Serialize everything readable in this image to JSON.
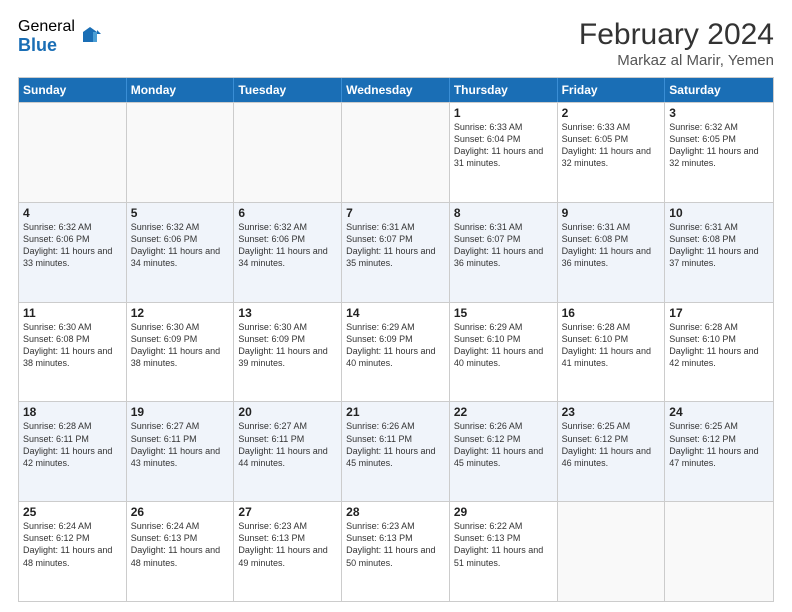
{
  "header": {
    "logo_general": "General",
    "logo_blue": "Blue",
    "month_year": "February 2024",
    "location": "Markaz al Marir, Yemen"
  },
  "days_of_week": [
    "Sunday",
    "Monday",
    "Tuesday",
    "Wednesday",
    "Thursday",
    "Friday",
    "Saturday"
  ],
  "weeks": [
    [
      {
        "day": "",
        "sunrise": "",
        "sunset": "",
        "daylight": ""
      },
      {
        "day": "",
        "sunrise": "",
        "sunset": "",
        "daylight": ""
      },
      {
        "day": "",
        "sunrise": "",
        "sunset": "",
        "daylight": ""
      },
      {
        "day": "",
        "sunrise": "",
        "sunset": "",
        "daylight": ""
      },
      {
        "day": "1",
        "sunrise": "Sunrise: 6:33 AM",
        "sunset": "Sunset: 6:04 PM",
        "daylight": "Daylight: 11 hours and 31 minutes."
      },
      {
        "day": "2",
        "sunrise": "Sunrise: 6:33 AM",
        "sunset": "Sunset: 6:05 PM",
        "daylight": "Daylight: 11 hours and 32 minutes."
      },
      {
        "day": "3",
        "sunrise": "Sunrise: 6:32 AM",
        "sunset": "Sunset: 6:05 PM",
        "daylight": "Daylight: 11 hours and 32 minutes."
      }
    ],
    [
      {
        "day": "4",
        "sunrise": "Sunrise: 6:32 AM",
        "sunset": "Sunset: 6:06 PM",
        "daylight": "Daylight: 11 hours and 33 minutes."
      },
      {
        "day": "5",
        "sunrise": "Sunrise: 6:32 AM",
        "sunset": "Sunset: 6:06 PM",
        "daylight": "Daylight: 11 hours and 34 minutes."
      },
      {
        "day": "6",
        "sunrise": "Sunrise: 6:32 AM",
        "sunset": "Sunset: 6:06 PM",
        "daylight": "Daylight: 11 hours and 34 minutes."
      },
      {
        "day": "7",
        "sunrise": "Sunrise: 6:31 AM",
        "sunset": "Sunset: 6:07 PM",
        "daylight": "Daylight: 11 hours and 35 minutes."
      },
      {
        "day": "8",
        "sunrise": "Sunrise: 6:31 AM",
        "sunset": "Sunset: 6:07 PM",
        "daylight": "Daylight: 11 hours and 36 minutes."
      },
      {
        "day": "9",
        "sunrise": "Sunrise: 6:31 AM",
        "sunset": "Sunset: 6:08 PM",
        "daylight": "Daylight: 11 hours and 36 minutes."
      },
      {
        "day": "10",
        "sunrise": "Sunrise: 6:31 AM",
        "sunset": "Sunset: 6:08 PM",
        "daylight": "Daylight: 11 hours and 37 minutes."
      }
    ],
    [
      {
        "day": "11",
        "sunrise": "Sunrise: 6:30 AM",
        "sunset": "Sunset: 6:08 PM",
        "daylight": "Daylight: 11 hours and 38 minutes."
      },
      {
        "day": "12",
        "sunrise": "Sunrise: 6:30 AM",
        "sunset": "Sunset: 6:09 PM",
        "daylight": "Daylight: 11 hours and 38 minutes."
      },
      {
        "day": "13",
        "sunrise": "Sunrise: 6:30 AM",
        "sunset": "Sunset: 6:09 PM",
        "daylight": "Daylight: 11 hours and 39 minutes."
      },
      {
        "day": "14",
        "sunrise": "Sunrise: 6:29 AM",
        "sunset": "Sunset: 6:09 PM",
        "daylight": "Daylight: 11 hours and 40 minutes."
      },
      {
        "day": "15",
        "sunrise": "Sunrise: 6:29 AM",
        "sunset": "Sunset: 6:10 PM",
        "daylight": "Daylight: 11 hours and 40 minutes."
      },
      {
        "day": "16",
        "sunrise": "Sunrise: 6:28 AM",
        "sunset": "Sunset: 6:10 PM",
        "daylight": "Daylight: 11 hours and 41 minutes."
      },
      {
        "day": "17",
        "sunrise": "Sunrise: 6:28 AM",
        "sunset": "Sunset: 6:10 PM",
        "daylight": "Daylight: 11 hours and 42 minutes."
      }
    ],
    [
      {
        "day": "18",
        "sunrise": "Sunrise: 6:28 AM",
        "sunset": "Sunset: 6:11 PM",
        "daylight": "Daylight: 11 hours and 42 minutes."
      },
      {
        "day": "19",
        "sunrise": "Sunrise: 6:27 AM",
        "sunset": "Sunset: 6:11 PM",
        "daylight": "Daylight: 11 hours and 43 minutes."
      },
      {
        "day": "20",
        "sunrise": "Sunrise: 6:27 AM",
        "sunset": "Sunset: 6:11 PM",
        "daylight": "Daylight: 11 hours and 44 minutes."
      },
      {
        "day": "21",
        "sunrise": "Sunrise: 6:26 AM",
        "sunset": "Sunset: 6:11 PM",
        "daylight": "Daylight: 11 hours and 45 minutes."
      },
      {
        "day": "22",
        "sunrise": "Sunrise: 6:26 AM",
        "sunset": "Sunset: 6:12 PM",
        "daylight": "Daylight: 11 hours and 45 minutes."
      },
      {
        "day": "23",
        "sunrise": "Sunrise: 6:25 AM",
        "sunset": "Sunset: 6:12 PM",
        "daylight": "Daylight: 11 hours and 46 minutes."
      },
      {
        "day": "24",
        "sunrise": "Sunrise: 6:25 AM",
        "sunset": "Sunset: 6:12 PM",
        "daylight": "Daylight: 11 hours and 47 minutes."
      }
    ],
    [
      {
        "day": "25",
        "sunrise": "Sunrise: 6:24 AM",
        "sunset": "Sunset: 6:12 PM",
        "daylight": "Daylight: 11 hours and 48 minutes."
      },
      {
        "day": "26",
        "sunrise": "Sunrise: 6:24 AM",
        "sunset": "Sunset: 6:13 PM",
        "daylight": "Daylight: 11 hours and 48 minutes."
      },
      {
        "day": "27",
        "sunrise": "Sunrise: 6:23 AM",
        "sunset": "Sunset: 6:13 PM",
        "daylight": "Daylight: 11 hours and 49 minutes."
      },
      {
        "day": "28",
        "sunrise": "Sunrise: 6:23 AM",
        "sunset": "Sunset: 6:13 PM",
        "daylight": "Daylight: 11 hours and 50 minutes."
      },
      {
        "day": "29",
        "sunrise": "Sunrise: 6:22 AM",
        "sunset": "Sunset: 6:13 PM",
        "daylight": "Daylight: 11 hours and 51 minutes."
      },
      {
        "day": "",
        "sunrise": "",
        "sunset": "",
        "daylight": ""
      },
      {
        "day": "",
        "sunrise": "",
        "sunset": "",
        "daylight": ""
      }
    ]
  ]
}
